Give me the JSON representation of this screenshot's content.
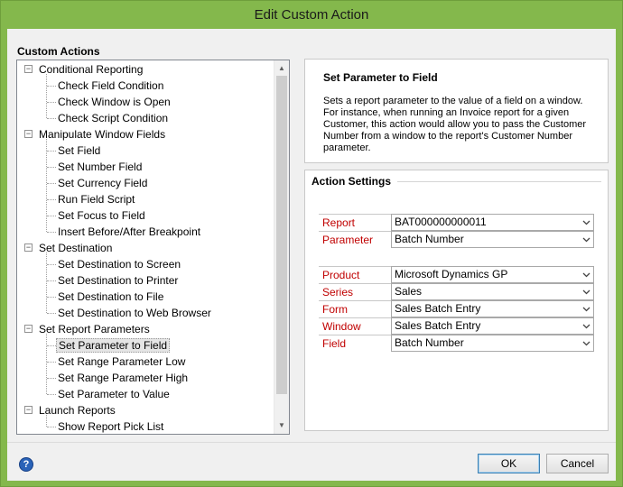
{
  "window": {
    "title": "Edit Custom Action"
  },
  "custom_actions": {
    "label": "Custom Actions",
    "groups": [
      {
        "label": "Conditional Reporting",
        "expander": "−",
        "items": [
          "Check Field Condition",
          "Check Window is Open",
          "Check Script Condition"
        ]
      },
      {
        "label": "Manipulate Window Fields",
        "expander": "−",
        "items": [
          "Set Field",
          "Set Number Field",
          "Set Currency Field",
          "Run Field Script",
          "Set Focus to Field",
          "Insert Before/After Breakpoint"
        ]
      },
      {
        "label": "Set Destination",
        "expander": "−",
        "items": [
          "Set Destination to Screen",
          "Set Destination to Printer",
          "Set Destination to File",
          "Set Destination to Web Browser"
        ]
      },
      {
        "label": "Set Report Parameters",
        "expander": "−",
        "items": [
          "Set Parameter to Field",
          "Set Range Parameter Low",
          "Set Range Parameter High",
          "Set Parameter to Value"
        ]
      },
      {
        "label": "Launch Reports",
        "expander": "−",
        "items": [
          "Show Report Pick List"
        ]
      }
    ],
    "selected_item": "Set Parameter to Field"
  },
  "description": {
    "title": "Set Parameter to Field",
    "body": "Sets a report parameter to the value of a field on a window. For instance, when running an Invoice report for a given Customer, this action would allow you to pass the Customer Number from a window to the report's Customer Number parameter."
  },
  "action_settings": {
    "title": "Action Settings",
    "fields": [
      {
        "label": "Report",
        "value": "BAT000000000011"
      },
      {
        "label": "Parameter",
        "value": "Batch Number"
      },
      {
        "label": "Product",
        "value": "Microsoft Dynamics GP"
      },
      {
        "label": "Series",
        "value": "Sales"
      },
      {
        "label": "Form",
        "value": "Sales Batch Entry"
      },
      {
        "label": "Window",
        "value": "Sales Batch Entry"
      },
      {
        "label": "Field",
        "value": "Batch Number"
      }
    ]
  },
  "footer": {
    "help_glyph": "?",
    "ok_label": "OK",
    "cancel_label": "Cancel"
  },
  "icons": {
    "help": "help-icon",
    "dropdown": "chevron-down-icon",
    "expand": "collapse-icon"
  },
  "colors": {
    "title_bar": "#84b84c",
    "field_label": "#c00000",
    "help_icon": "#2a63b8"
  }
}
